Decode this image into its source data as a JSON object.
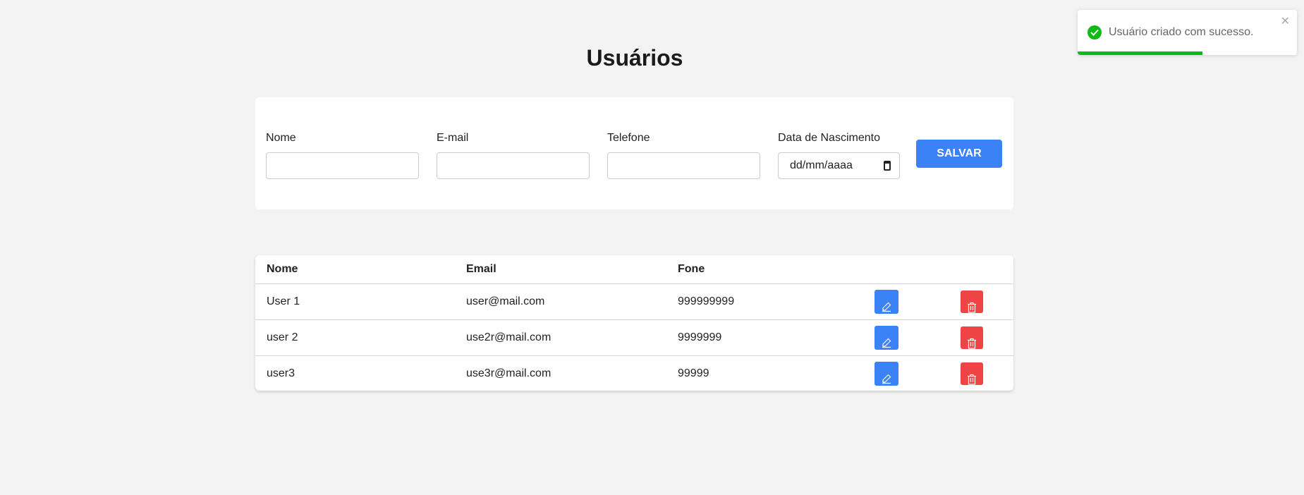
{
  "page": {
    "title": "Usuários"
  },
  "form": {
    "fields": [
      {
        "label": "Nome",
        "value": ""
      },
      {
        "label": "E-mail",
        "value": ""
      },
      {
        "label": "Telefone",
        "value": ""
      },
      {
        "label": "Data de Nascimento",
        "placeholder": "dd/mm/aaaa"
      }
    ],
    "save_label": "SALVAR"
  },
  "table": {
    "headers": [
      "Nome",
      "Email",
      "Fone"
    ],
    "rows": [
      {
        "nome": "User 1",
        "email": "user@mail.com",
        "fone": "999999999"
      },
      {
        "nome": "user 2",
        "email": "use2r@mail.com",
        "fone": "9999999"
      },
      {
        "nome": "user3",
        "email": "use3r@mail.com",
        "fone": "99999"
      }
    ]
  },
  "toast": {
    "message": "Usuário criado com sucesso.",
    "close": "✕",
    "progress": 0.57
  },
  "colors": {
    "primary": "#3b82f6",
    "danger": "#ef4444",
    "success": "#0fba17"
  }
}
